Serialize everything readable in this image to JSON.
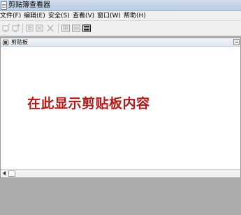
{
  "window": {
    "title": "剪贴簿查看器"
  },
  "menu": [
    {
      "label": "文件(F)"
    },
    {
      "label": "编辑(E)"
    },
    {
      "label": "安全(S)"
    },
    {
      "label": "查看(V)"
    },
    {
      "label": "窗口(W)"
    },
    {
      "label": "帮助(H)"
    }
  ],
  "toolbar": {
    "buttons": [
      "connect-icon",
      "disconnect-icon",
      "share-icon",
      "unshare-icon",
      "delete-icon",
      "table-of-contents-icon",
      "page-icon",
      "thumbnail-icon"
    ]
  },
  "child_window": {
    "title": "剪贴板",
    "placeholder": "在此显示剪贴板内容"
  }
}
